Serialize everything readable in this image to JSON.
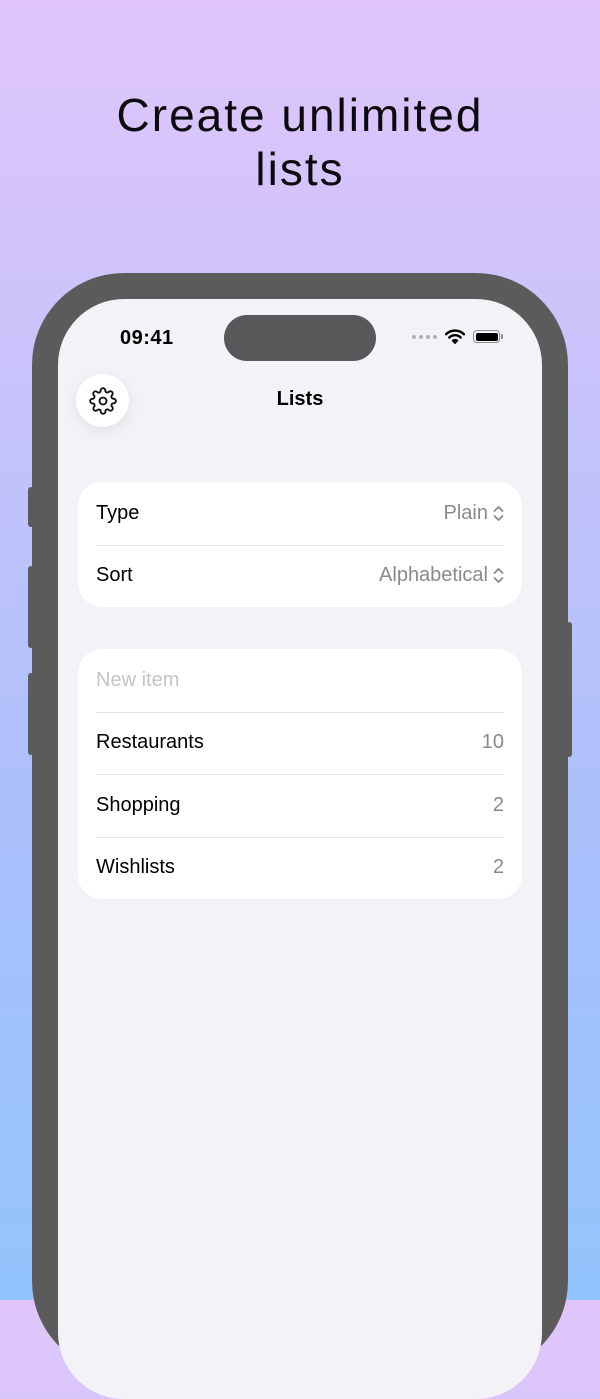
{
  "headline": {
    "line1": "Create unlimited",
    "line2": "lists"
  },
  "status_bar": {
    "time": "09:41",
    "icons": [
      "signal-dots-icon",
      "wifi-icon",
      "battery-icon"
    ]
  },
  "nav": {
    "title": "Lists",
    "settings_icon": "gear-icon"
  },
  "settings_card": {
    "type_label": "Type",
    "type_value": "Plain",
    "sort_label": "Sort",
    "sort_value": "Alphabetical",
    "selector_icon": "chevron-up-down-icon"
  },
  "lists_card": {
    "new_item_placeholder": "New item",
    "items": [
      {
        "name": "Restaurants",
        "count": "10"
      },
      {
        "name": "Shopping",
        "count": "2"
      },
      {
        "name": "Wishlists",
        "count": "2"
      }
    ]
  },
  "colors": {
    "background_top": "#e0c6fb",
    "background_bottom": "#93c4fd",
    "phone_frame": "#5b5b5b",
    "screen_background": "#f2f2f7",
    "secondary_text": "#8a8a8e"
  }
}
